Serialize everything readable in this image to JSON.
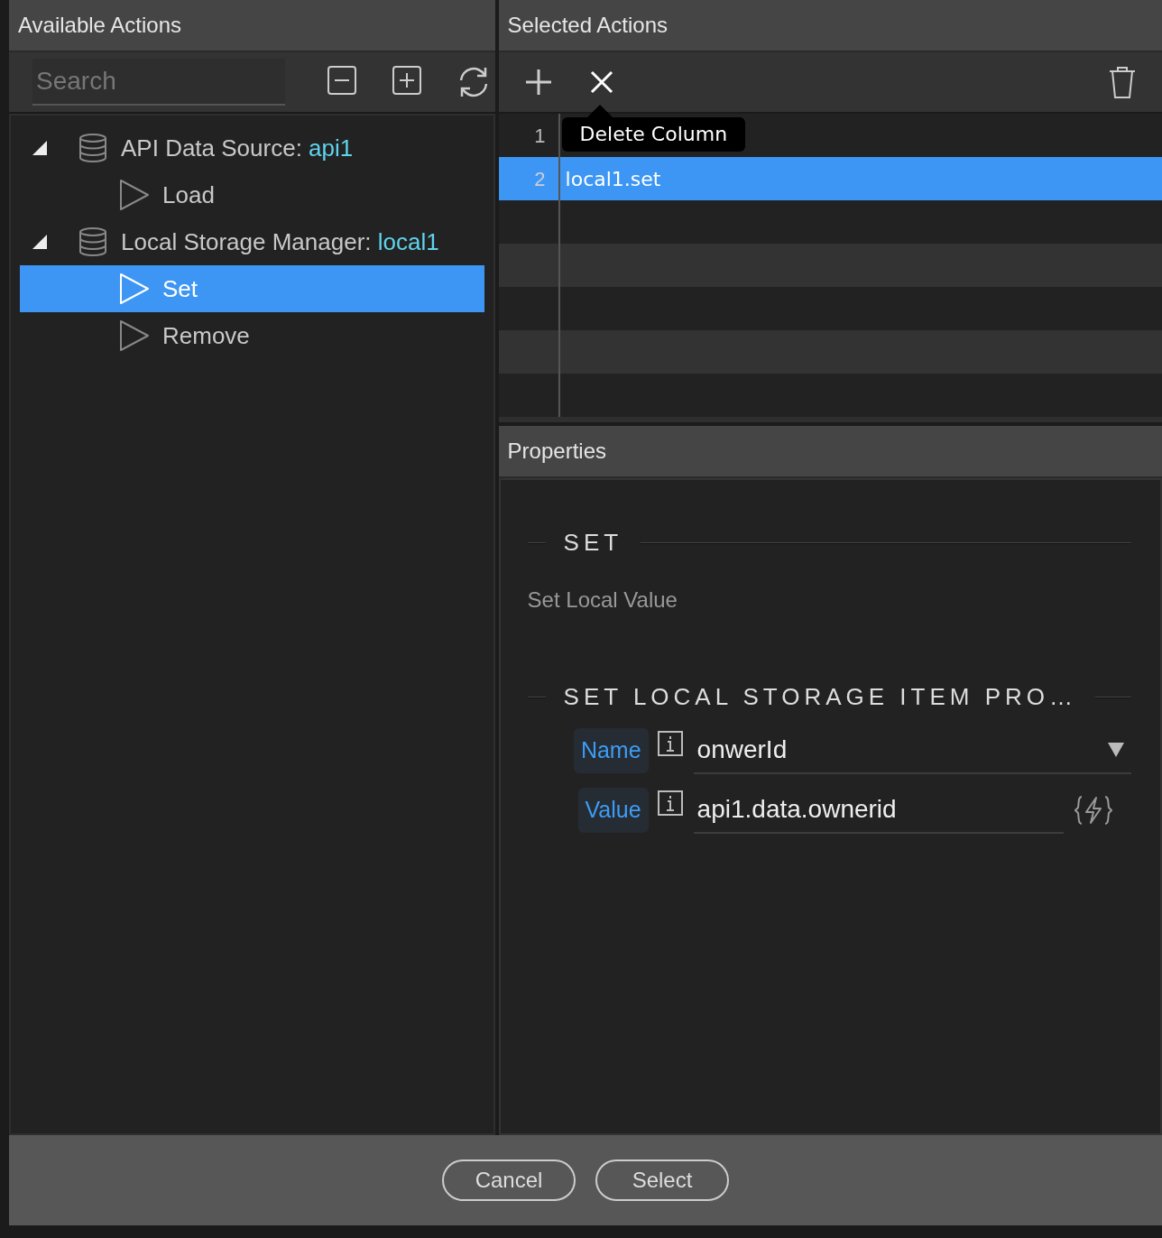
{
  "available": {
    "title": "Available Actions",
    "search": {
      "placeholder": "Search"
    },
    "tree": [
      {
        "label": "API Data Source:",
        "ref": "api1",
        "expanded": true,
        "selected": false,
        "children": [
          {
            "label": "Load",
            "selected": false
          }
        ]
      },
      {
        "label": "Local Storage Manager:",
        "ref": "local1",
        "expanded": true,
        "selected": false,
        "children": [
          {
            "label": "Set",
            "selected": true
          },
          {
            "label": "Remove",
            "selected": false
          }
        ]
      }
    ]
  },
  "selected_actions": {
    "title": "Selected Actions",
    "rows": [
      {
        "number": "1",
        "selected": false
      },
      {
        "number": "2",
        "text": "local1.set",
        "selected": true
      }
    ],
    "tooltip": {
      "text": "Delete Column"
    }
  },
  "properties": {
    "title": "Properties",
    "sections": [
      {
        "heading": "SET",
        "description": "Set Local Value"
      },
      {
        "heading": "SET LOCAL STORAGE ITEM PRO…",
        "fields": [
          {
            "label": "Name",
            "value": "onwerId",
            "kind": "dropdown"
          },
          {
            "label": "Value",
            "value": "api1.data.ownerid",
            "kind": "expression"
          }
        ]
      }
    ]
  },
  "buttons": [
    "Cancel",
    "Select"
  ]
}
